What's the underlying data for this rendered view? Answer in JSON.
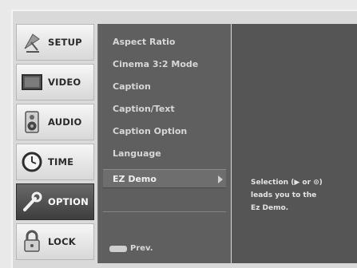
{
  "sidebar": {
    "items": [
      {
        "label": "SETUP",
        "icon": "satellite-dish-icon"
      },
      {
        "label": "VIDEO",
        "icon": "tv-screen-icon"
      },
      {
        "label": "AUDIO",
        "icon": "speaker-icon"
      },
      {
        "label": "TIME",
        "icon": "clock-icon"
      },
      {
        "label": "OPTION",
        "icon": "wrench-icon"
      },
      {
        "label": "LOCK",
        "icon": "padlock-icon"
      }
    ],
    "active_index": 4
  },
  "menu": {
    "items": [
      {
        "label": "Aspect Ratio"
      },
      {
        "label": "Cinema 3:2 Mode"
      },
      {
        "label": "Caption"
      },
      {
        "label": "Caption/Text"
      },
      {
        "label": "Caption Option"
      },
      {
        "label": "Language"
      },
      {
        "label": "EZ Demo"
      }
    ],
    "selected_index": 6,
    "hint_label": "Prev."
  },
  "info": {
    "lines": [
      "Selection (▶ or ⊙)",
      "leads you to the",
      "Ez Demo."
    ]
  }
}
